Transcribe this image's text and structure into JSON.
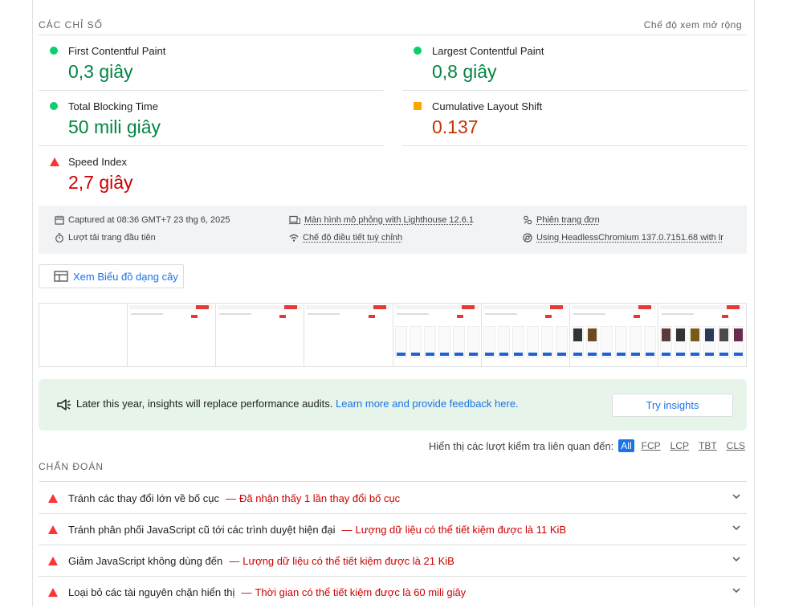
{
  "metrics_section": {
    "title": "CÁC CHỈ SỐ",
    "expand_label": "Chế độ xem mở rộng"
  },
  "metrics": [
    {
      "name": "First Contentful Paint",
      "value": "0,3 giây",
      "status": "pass"
    },
    {
      "name": "Largest Contentful Paint",
      "value": "0,8 giây",
      "status": "pass"
    },
    {
      "name": "Total Blocking Time",
      "value": "50 mili giây",
      "status": "pass"
    },
    {
      "name": "Cumulative Layout Shift",
      "value": "0.137",
      "status": "average"
    },
    {
      "name": "Speed Index",
      "value": "2,7 giây",
      "status": "fail"
    }
  ],
  "run_info": {
    "captured": "Captured at 08:36 GMT+7 23 thg 6, 2025",
    "load": "Lượt tải trang đầu tiên",
    "device": "Màn hình mô phỏng with Lighthouse 12.6.1",
    "throttling": "Chế độ điều tiết tuỳ chỉnh",
    "session": "Phiên trang đơn",
    "browser": "Using HeadlessChromium 137.0.7151.68 with lr"
  },
  "treemap_button": "Xem Biểu đồ dạng cây",
  "insight": {
    "text": "Later this year, insights will replace performance audits.",
    "link": "Learn more and provide feedback here.",
    "button": "Try insights"
  },
  "filter": {
    "label": "Hiển thị các lượt kiểm tra liên quan đến:",
    "chips": [
      "All",
      "FCP",
      "LCP",
      "TBT",
      "CLS"
    ]
  },
  "diagnostics": {
    "title": "CHẨN ĐOÁN",
    "items": [
      {
        "title": "Tránh các thay đổi lớn về bố cục",
        "detail": "Đã nhận thấy 1 lần thay đổi bố cục"
      },
      {
        "title": "Tránh phân phối JavaScript cũ tới các trình duyệt hiện đại",
        "detail": "Lượng dữ liệu có thể tiết kiệm được là 11 KiB"
      },
      {
        "title": "Giảm JavaScript không dùng đến",
        "detail": "Lượng dữ liệu có thể tiết kiệm được là 21 KiB"
      },
      {
        "title": "Loại bỏ các tài nguyên chặn hiển thị",
        "detail": "Thời gian có thể tiết kiệm được là 60 mili giây"
      }
    ]
  },
  "colors": {
    "pass": "#0cce6b",
    "average": "#ffa400",
    "fail": "#ff3333",
    "pass_text": "#018642",
    "average_text": "#c33300",
    "fail_text": "#cc0000",
    "accent": "#1a73e8"
  },
  "icons": [
    "calendar-icon",
    "timer-icon",
    "device-icon",
    "wifi-icon",
    "person-icon",
    "chrome-icon",
    "treemap-icon",
    "megaphone-icon",
    "chevron-down-icon"
  ]
}
